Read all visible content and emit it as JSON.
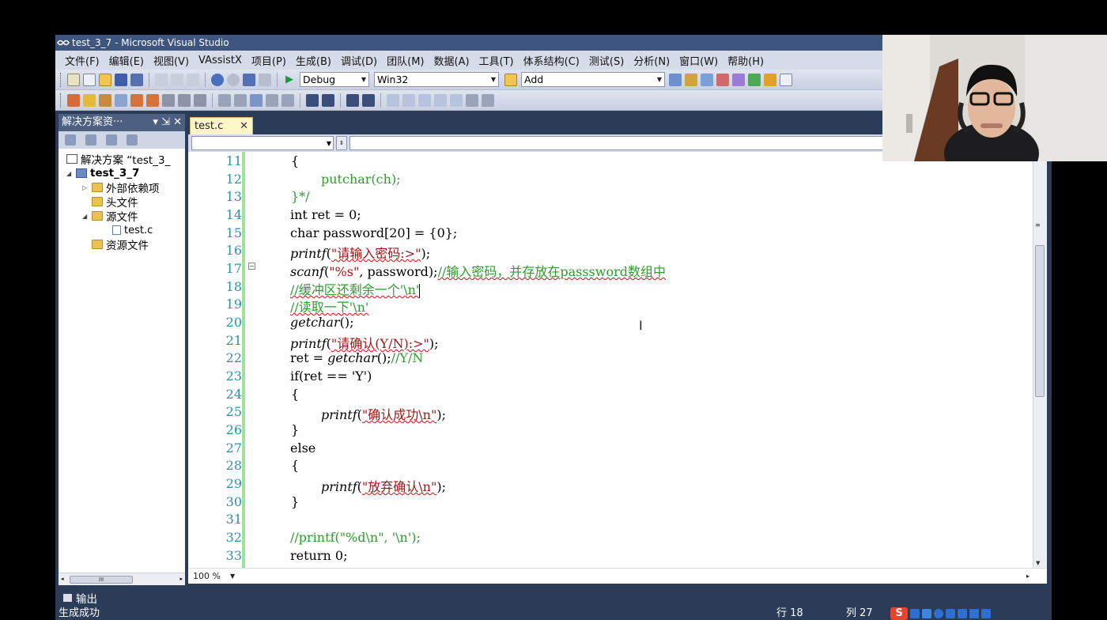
{
  "window": {
    "title": "test_3_7 - Microsoft Visual Studio"
  },
  "menu": [
    "文件(F)",
    "编辑(E)",
    "视图(V)",
    "VAssistX",
    "项目(P)",
    "生成(B)",
    "调试(D)",
    "团队(M)",
    "数据(A)",
    "工具(T)",
    "体系结构(C)",
    "测试(S)",
    "分析(N)",
    "窗口(W)",
    "帮助(H)"
  ],
  "toolbar": {
    "config": "Debug",
    "platform": "Win32",
    "find": "Add"
  },
  "solution_explorer": {
    "title": "解决方案资···",
    "header_controls": "▾ ⇲ ✕",
    "items": [
      {
        "label": "解决方案 “test_3_",
        "level": 0
      },
      {
        "label": "test_3_7",
        "level": 0
      },
      {
        "label": "外部依赖项",
        "level": 1
      },
      {
        "label": "头文件",
        "level": 1
      },
      {
        "label": "源文件",
        "level": 1
      },
      {
        "label": "test.c",
        "level": 2
      },
      {
        "label": "资源文件",
        "level": 1
      }
    ],
    "scroll_thumb": "III"
  },
  "editor": {
    "tab": "test.c",
    "tab_close": "✕",
    "nav_left": "",
    "zoom": "100 %",
    "lines": [
      "11",
      "12",
      "13",
      "14",
      "15",
      "16",
      "17",
      "18",
      "19",
      "20",
      "21",
      "22",
      "23",
      "24",
      "25",
      "26",
      "27",
      "28",
      "29",
      "30",
      "31",
      "32",
      "33"
    ],
    "code": {
      "l11": "{",
      "l12_fn": "putchar(ch);",
      "l13": "}*/",
      "l14": "int ret = 0;",
      "l15": "char password[20] = {0};",
      "l16_fn": "printf",
      "l16_open": "(",
      "l16_str": "\"请输入密码:>\"",
      "l16_close": ");",
      "l17_fn": "scanf",
      "l17_open": "(",
      "l17_str": "\"%s\"",
      "l17_mid": ", password);",
      "l17_cmt": "//输入密码，并存放在passsword数组中",
      "l18_cmt": "//缓冲区还剩余一个'\\n'",
      "l19_cmt": "//读取一下'\\n'",
      "l20_fn": "getchar",
      "l20_rest": "();",
      "l21_fn": "printf",
      "l21_open": "(",
      "l21_str": "\"请确认(Y/N):>\"",
      "l21_close": ");",
      "l22_pre": "ret = ",
      "l22_fn": "getchar",
      "l22_rest": "();",
      "l22_cmt": "//Y/N",
      "l23": "if(ret == 'Y')",
      "l24": "{",
      "l25_fn": "printf",
      "l25_open": "(",
      "l25_str": "\"确认成功\\n\"",
      "l25_close": ");",
      "l26": "}",
      "l27": "else",
      "l28": "{",
      "l29_fn": "printf",
      "l29_open": "(",
      "l29_str": "\"放弃确认\\n\"",
      "l29_close": ");",
      "l30": "}",
      "l31": "",
      "l32_cmt": "//printf(\"%d\\n\", '\\n');",
      "l33": "return 0;"
    }
  },
  "bottom": {
    "output_tab": "输出",
    "status": "生成成功",
    "row": "行 18",
    "col": "列 27",
    "ime_logo": "S"
  },
  "colors": {
    "vs_frame": "#2b3c59",
    "comment": "#2e9b2e",
    "string": "#a31515",
    "line_number": "#2b91af",
    "change_bar": "#9ee29e"
  }
}
